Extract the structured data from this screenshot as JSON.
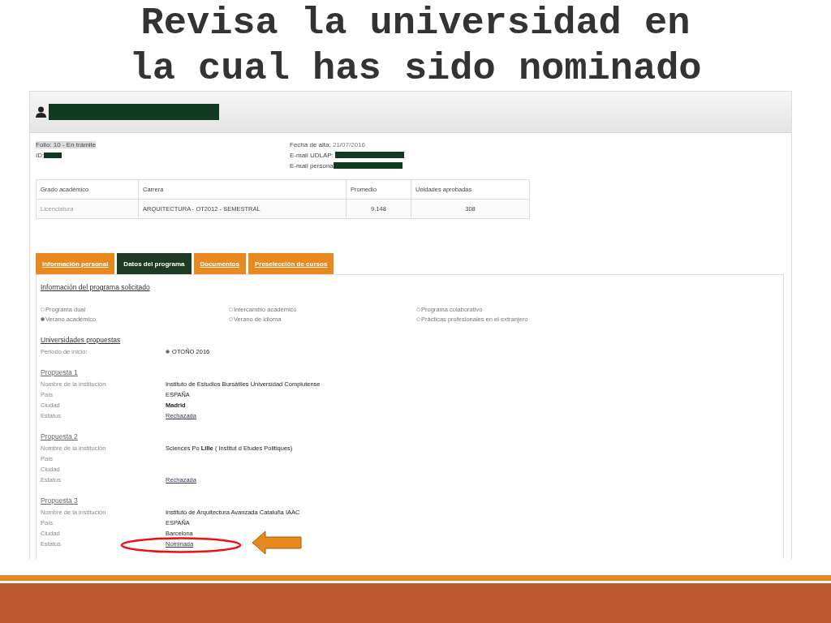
{
  "slide_title": "Revisa la universidad en la cual has sido nominado",
  "profile": {
    "folio": "Folio: 10 - En trámite",
    "id_label": "ID:",
    "fecha_label": "Fecha de alta:",
    "fecha_value": "21/07/2016",
    "email_udlap_label": "E-mail UDLAP:",
    "email_personal_label": "E-mail persona"
  },
  "table": {
    "columns": [
      "Grado académico",
      "Carrera",
      "Promedio",
      "Unidades aprobadas"
    ],
    "rows": [
      [
        "Licenciatura",
        "ARQUITECTURA - OT2012 - SEMESTRAL",
        "9.148",
        "308"
      ]
    ]
  },
  "tabs": [
    {
      "label": "Información personal",
      "selected": false
    },
    {
      "label": "Datos del programa",
      "selected": true
    },
    {
      "label": "Documentos",
      "selected": false
    },
    {
      "label": "Preselección de cursos",
      "selected": false
    }
  ],
  "program_heading": "Información del programa solicitado",
  "program_options": [
    {
      "label": "Programa dual",
      "selected": false
    },
    {
      "label": "Intercambio académico",
      "selected": false
    },
    {
      "label": "Programa colaborativo",
      "selected": false
    },
    {
      "label": "Verano académico",
      "selected": true
    },
    {
      "label": "Verano de idioma",
      "selected": false
    },
    {
      "label": "Prácticas profesionales en el extranjero",
      "selected": false
    }
  ],
  "universities_heading": "Universidades propuestas",
  "period": {
    "label": "Periodo de inicio:",
    "option": "OTOÑO 2016",
    "selected": true
  },
  "proposals": [
    {
      "title": "Propuesta 1",
      "fields": [
        {
          "label": "Nombre de la institución",
          "value": "Instituto de Estudios Bursátiles Universidad Complutense",
          "kind": "text",
          "highlighted": false
        },
        {
          "label": "País",
          "value": "ESPAÑA",
          "kind": "text",
          "highlighted": false
        },
        {
          "label": "Ciudad",
          "value": "Madrid",
          "kind": "bold",
          "highlighted": false
        },
        {
          "label": "Estatus",
          "value": "Rechazada",
          "kind": "link",
          "highlighted": false
        }
      ]
    },
    {
      "title": "Propuesta 2",
      "fields": [
        {
          "label": "Nombre de la institución",
          "value": "Sciences Po **Lille** ( Institut d Etudes Politiques)",
          "kind": "text",
          "highlighted": false
        },
        {
          "label": "País"
        },
        {
          "label": "Ciudad"
        },
        {
          "label": "Estatus",
          "value": "Rechazada",
          "kind": "link",
          "highlighted": false
        }
      ]
    },
    {
      "title": "Propuesta 3",
      "fields": [
        {
          "label": "Nombre de la institución",
          "value": "Instituto de Arquitectura Avanzada Cataluña IAAC",
          "kind": "text",
          "highlighted": false
        },
        {
          "label": "País",
          "value": "ESPAÑA",
          "kind": "text",
          "highlighted": false
        },
        {
          "label": "Ciudad",
          "value": "Barcelona",
          "kind": "text",
          "highlighted": false
        },
        {
          "label": "Estatus",
          "value": "Nominada",
          "kind": "link",
          "highlighted": true
        }
      ]
    }
  ]
}
